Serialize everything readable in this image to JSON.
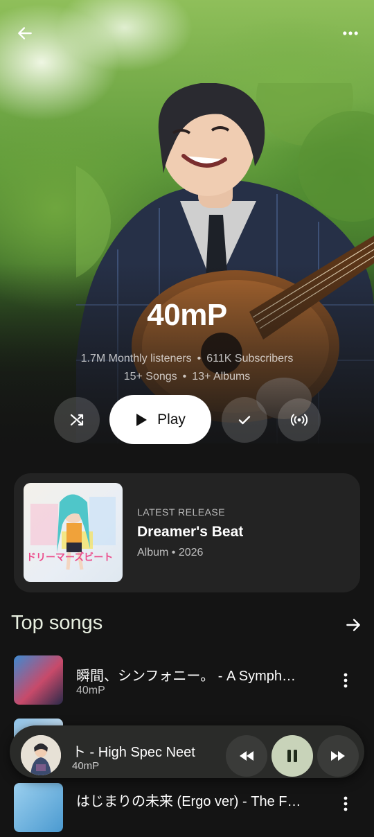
{
  "icons": {
    "back": "arrow-left-icon",
    "more": "more-horizontal-icon",
    "shuffle": "shuffle-icon",
    "play": "play-icon",
    "subscribed": "check-icon",
    "radio": "radio-broadcast-icon",
    "see_all": "arrow-right-icon",
    "song_menu": "more-vertical-icon",
    "rewind": "rewind-icon",
    "pause": "pause-icon",
    "fast_forward": "fast-forward-icon"
  },
  "colors": {
    "background": "#141414",
    "card": "#232323",
    "play_button": "#ffffff",
    "section_title": "#e8efe0",
    "pause_button": "#c8d3b9"
  },
  "artist": {
    "name": "40mP",
    "monthly_listeners": "1.7M Monthly listeners",
    "subscribers": "611K Subscribers",
    "songs": "15+ Songs",
    "albums": "13+ Albums",
    "separator": "•"
  },
  "actions": {
    "play_label": "Play"
  },
  "latest_release": {
    "kicker": "LATEST RELEASE",
    "title": "Dreamer's Beat",
    "subtitle": "Album • 2026",
    "cover_text": "ドリーマーズビート"
  },
  "top_songs": {
    "title": "Top songs",
    "items": [
      {
        "title": "瞬間、シンフォニー。 - A Symph…",
        "artist": "40mP"
      },
      {
        "title": "",
        "artist": ""
      },
      {
        "title": "はじまりの未来 (Ergo ver) - The F…",
        "artist": ""
      }
    ]
  },
  "now_playing": {
    "title": "ト - High Spec Neet",
    "artist": "40mP"
  }
}
